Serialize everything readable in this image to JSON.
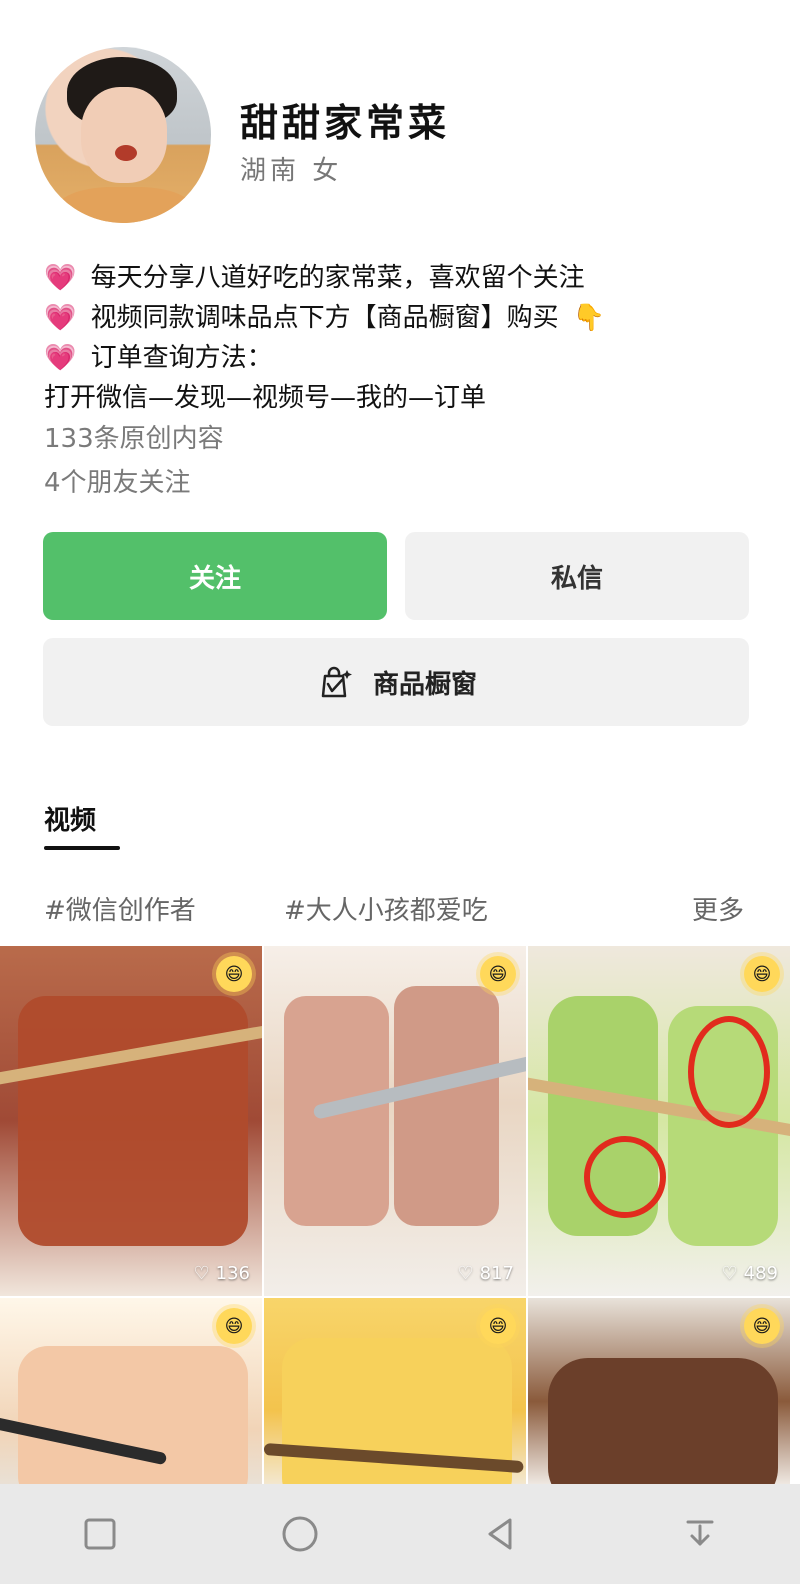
{
  "profile": {
    "name": "甜甜家常菜",
    "subtitle": "湖南  女",
    "bio_lines": [
      "每天分享八道好吃的家常菜，喜欢留个关注",
      "视频同款调味品点下方【商品橱窗】购买",
      "订单查询方法：",
      "打开微信—发现—视频号—我的—订单"
    ],
    "stats": {
      "original_count": "133条原创内容",
      "friends_following": "4个朋友关注"
    }
  },
  "actions": {
    "follow": "关注",
    "message": "私信",
    "shop": "商品橱窗"
  },
  "tabs": {
    "video": "视频"
  },
  "tags": {
    "tag1": "#微信创作者",
    "tag2": "#大人小孩都爱吃",
    "more": "更多"
  },
  "grid": {
    "items": [
      {
        "likes": "136"
      },
      {
        "likes": "817"
      },
      {
        "likes": "489"
      },
      {
        "likes": ""
      },
      {
        "likes": ""
      },
      {
        "likes": ""
      }
    ]
  },
  "icons": {
    "heart": "heart-icon",
    "pointer": "pointing-down-icon",
    "shop": "shopping-bag-icon",
    "emoji": "laughing-sun-icon",
    "nav": [
      "square-icon",
      "circle-icon",
      "back-triangle-icon",
      "down-arrow-icon"
    ]
  },
  "colors": {
    "primary_green": "#53c06a",
    "button_gray": "#f1f1f1",
    "text_dark": "#111111",
    "text_muted": "#7a7a7a"
  }
}
